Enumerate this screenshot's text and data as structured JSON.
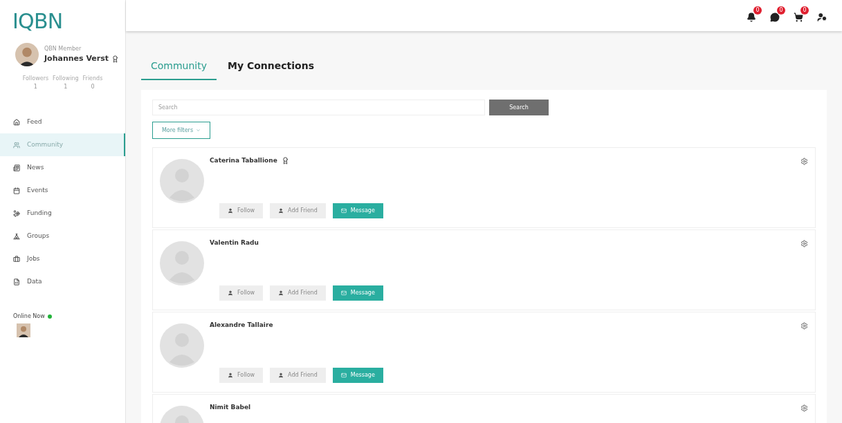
{
  "logo": "IQBN",
  "profile": {
    "role": "QBN Member",
    "name": "Johannes Verst",
    "stats": [
      {
        "label": "Followers",
        "value": "1"
      },
      {
        "label": "Following",
        "value": "1"
      },
      {
        "label": "Friends",
        "value": "0"
      }
    ]
  },
  "sidebar": {
    "items": [
      {
        "label": "Feed",
        "kind": "home",
        "selected": false
      },
      {
        "label": "Community",
        "kind": "community",
        "selected": true
      },
      {
        "label": "News",
        "kind": "news",
        "selected": false
      },
      {
        "label": "Events",
        "kind": "events",
        "selected": false
      },
      {
        "label": "Funding",
        "kind": "funding",
        "selected": false
      },
      {
        "label": "Groups",
        "kind": "groups",
        "selected": false
      },
      {
        "label": "Jobs",
        "kind": "jobs",
        "selected": false
      },
      {
        "label": "Data",
        "kind": "data",
        "selected": false
      }
    ],
    "online_now": "Online Now"
  },
  "topbar": {
    "badges": [
      {
        "kind": "bell",
        "count": "0"
      },
      {
        "kind": "chat",
        "count": "0"
      },
      {
        "kind": "cart",
        "count": "0"
      },
      {
        "kind": "user-settings"
      }
    ]
  },
  "tabs": [
    {
      "label": "Community",
      "selected": true
    },
    {
      "label": "My Connections",
      "selected": false
    }
  ],
  "search": {
    "placeholder": "Search",
    "button": "Search"
  },
  "filters_button": "More filters",
  "members": [
    {
      "name": "Caterina Taballione",
      "badge": true,
      "actions": [
        "Follow",
        "Add Friend",
        "Message"
      ]
    },
    {
      "name": "Valentin Radu",
      "badge": false,
      "actions": [
        "Follow",
        "Add Friend",
        "Message"
      ]
    },
    {
      "name": "Alexandre Tallaire",
      "badge": false,
      "actions": [
        "Follow",
        "Add Friend",
        "Message"
      ]
    },
    {
      "name": "Nimit Babel",
      "badge": false
    }
  ]
}
